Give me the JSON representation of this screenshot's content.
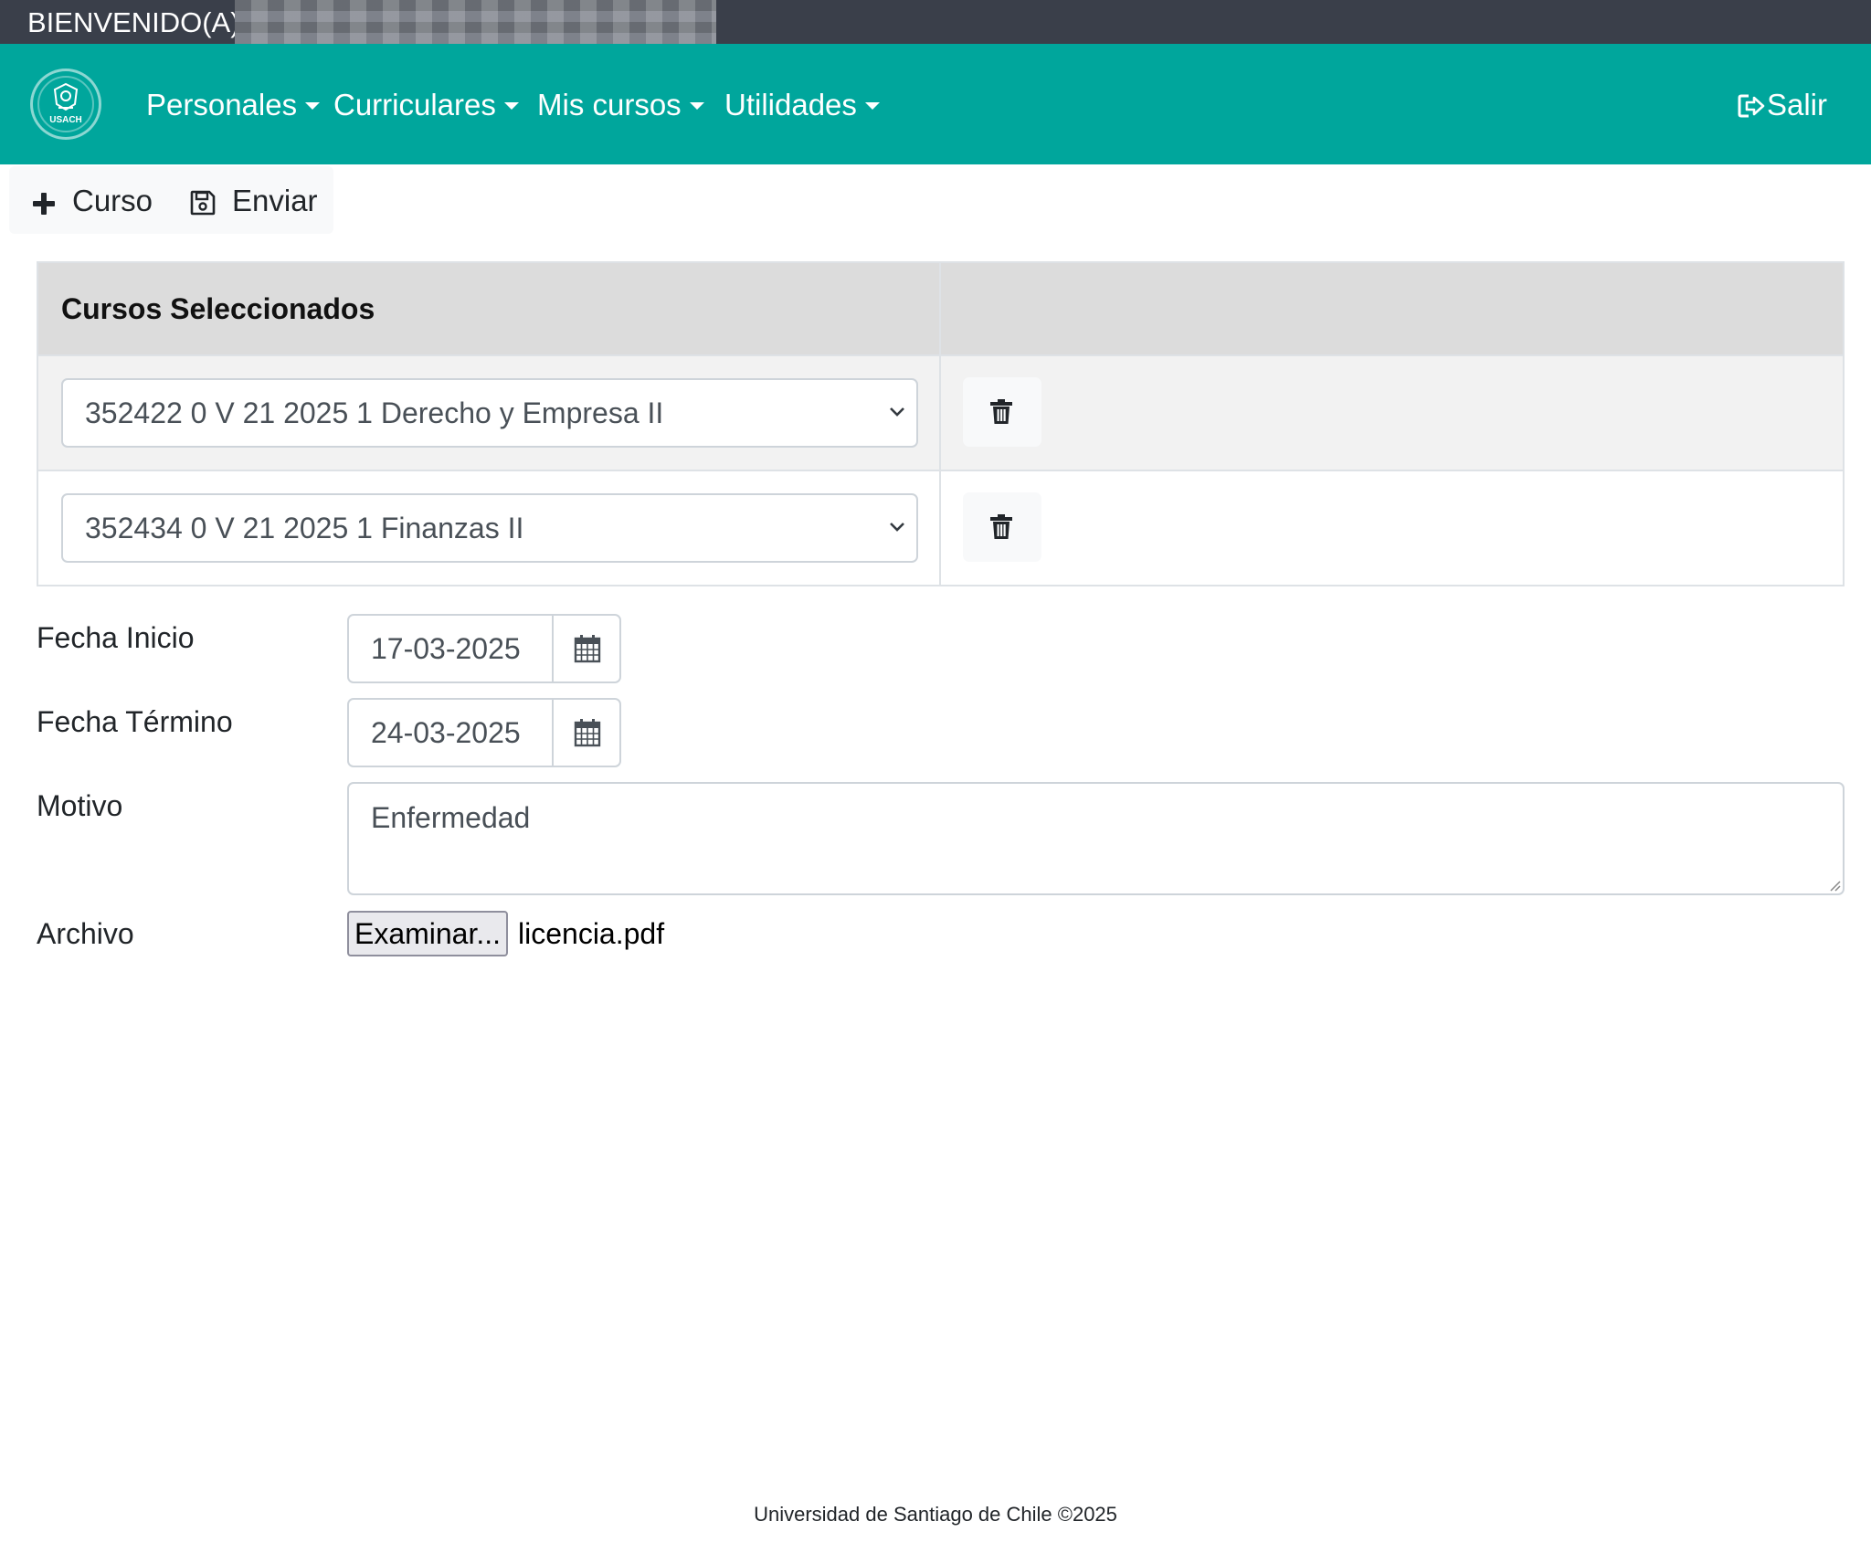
{
  "header": {
    "welcome": "BIENVENIDO(A)"
  },
  "navbar": {
    "logo_text": "USACH",
    "menu": [
      {
        "label": "Personales"
      },
      {
        "label": "Curriculares"
      },
      {
        "label": "Mis cursos"
      },
      {
        "label": "Utilidades"
      }
    ],
    "logout_label": "Salir",
    "brand_color": "#00a69c"
  },
  "toolbar": {
    "add_course_label": "Curso",
    "send_label": "Enviar"
  },
  "courses_table": {
    "header": "Cursos Seleccionados",
    "rows": [
      {
        "selected": "352422 0 V 21 2025 1 Derecho y Empresa II"
      },
      {
        "selected": "352434 0 V 21 2025 1 Finanzas II"
      }
    ]
  },
  "form": {
    "start_date_label": "Fecha Inicio",
    "start_date_value": "17-03-2025",
    "end_date_label": "Fecha Término",
    "end_date_value": "24-03-2025",
    "reason_label": "Motivo",
    "reason_value": "Enfermedad",
    "file_label": "Archivo",
    "file_button": "Examinar...",
    "file_name": "licencia.pdf"
  },
  "footer": {
    "text": "Universidad de Santiago de Chile ©2025"
  }
}
